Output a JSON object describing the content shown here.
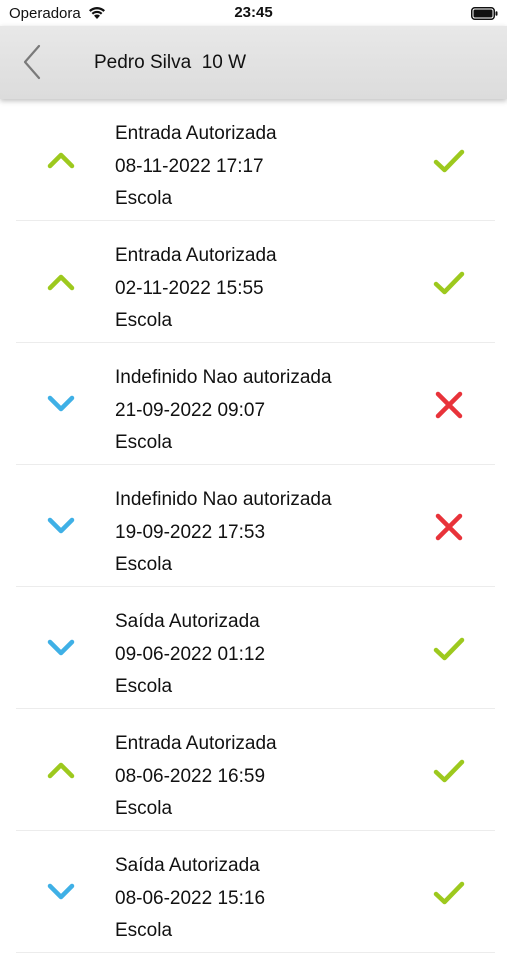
{
  "status_bar": {
    "carrier": "Operadora",
    "time": "23:45"
  },
  "nav": {
    "title": "Pedro Silva  10 W"
  },
  "colors": {
    "green": "#9dc91e",
    "blue": "#3fb0e6",
    "red": "#e8333a"
  },
  "records": [
    {
      "direction": "up",
      "status": "authorized",
      "type": "Entrada Autorizada",
      "datetime": "08-11-2022 17:17",
      "location": "Escola"
    },
    {
      "direction": "up",
      "status": "authorized",
      "type": "Entrada Autorizada",
      "datetime": "02-11-2022 15:55",
      "location": "Escola"
    },
    {
      "direction": "down",
      "status": "denied",
      "type": "Indefinido Nao autorizada",
      "datetime": "21-09-2022 09:07",
      "location": "Escola"
    },
    {
      "direction": "down",
      "status": "denied",
      "type": "Indefinido Nao autorizada",
      "datetime": "19-09-2022 17:53",
      "location": "Escola"
    },
    {
      "direction": "down",
      "status": "authorized",
      "type": "Saída Autorizada",
      "datetime": "09-06-2022 01:12",
      "location": "Escola"
    },
    {
      "direction": "up",
      "status": "authorized",
      "type": "Entrada Autorizada",
      "datetime": "08-06-2022 16:59",
      "location": "Escola"
    },
    {
      "direction": "down",
      "status": "authorized",
      "type": "Saída Autorizada",
      "datetime": "08-06-2022 15:16",
      "location": "Escola"
    }
  ]
}
